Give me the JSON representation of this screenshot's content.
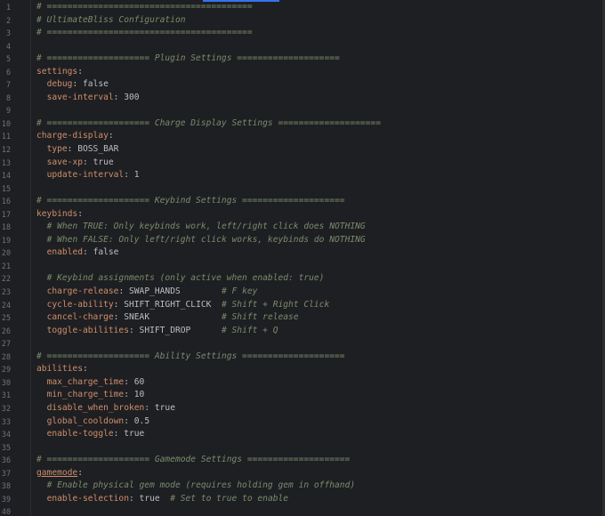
{
  "editor": {
    "language": "yaml",
    "colors": {
      "background": "#1e1f22",
      "line_number": "#6f737a",
      "comment": "#7a8c6e",
      "key": "#cf8e6d",
      "value": "#bcbec4",
      "accent": "#3574f0"
    },
    "lines": [
      {
        "n": "1",
        "tokens": [
          {
            "t": "comment",
            "v": "# ========================================"
          }
        ]
      },
      {
        "n": "2",
        "tokens": [
          {
            "t": "comment",
            "v": "# UltimateBliss Configuration"
          }
        ]
      },
      {
        "n": "3",
        "tokens": [
          {
            "t": "comment",
            "v": "# ========================================"
          }
        ]
      },
      {
        "n": "4",
        "tokens": []
      },
      {
        "n": "5",
        "tokens": [
          {
            "t": "comment",
            "v": "# ==================== Plugin Settings ===================="
          }
        ]
      },
      {
        "n": "6",
        "tokens": [
          {
            "t": "key",
            "v": "settings"
          },
          {
            "t": "punct",
            "v": ":"
          }
        ]
      },
      {
        "n": "7",
        "tokens": [
          {
            "t": "value",
            "v": "  "
          },
          {
            "t": "key",
            "v": "debug"
          },
          {
            "t": "punct",
            "v": ": "
          },
          {
            "t": "value",
            "v": "false"
          }
        ]
      },
      {
        "n": "8",
        "tokens": [
          {
            "t": "value",
            "v": "  "
          },
          {
            "t": "key",
            "v": "save-interval"
          },
          {
            "t": "punct",
            "v": ": "
          },
          {
            "t": "value",
            "v": "300"
          }
        ]
      },
      {
        "n": "9",
        "tokens": []
      },
      {
        "n": "10",
        "tokens": [
          {
            "t": "comment",
            "v": "# ==================== Charge Display Settings ===================="
          }
        ]
      },
      {
        "n": "11",
        "tokens": [
          {
            "t": "key",
            "v": "charge-display"
          },
          {
            "t": "punct",
            "v": ":"
          }
        ]
      },
      {
        "n": "12",
        "tokens": [
          {
            "t": "value",
            "v": "  "
          },
          {
            "t": "key",
            "v": "type"
          },
          {
            "t": "punct",
            "v": ": "
          },
          {
            "t": "value",
            "v": "BOSS_BAR"
          }
        ]
      },
      {
        "n": "13",
        "tokens": [
          {
            "t": "value",
            "v": "  "
          },
          {
            "t": "key",
            "v": "save-xp"
          },
          {
            "t": "punct",
            "v": ": "
          },
          {
            "t": "value",
            "v": "true"
          }
        ]
      },
      {
        "n": "14",
        "tokens": [
          {
            "t": "value",
            "v": "  "
          },
          {
            "t": "key",
            "v": "update-interval"
          },
          {
            "t": "punct",
            "v": ": "
          },
          {
            "t": "value",
            "v": "1"
          }
        ]
      },
      {
        "n": "15",
        "tokens": []
      },
      {
        "n": "16",
        "tokens": [
          {
            "t": "comment",
            "v": "# ==================== Keybind Settings ===================="
          }
        ]
      },
      {
        "n": "17",
        "tokens": [
          {
            "t": "key",
            "v": "keybinds"
          },
          {
            "t": "punct",
            "v": ":"
          }
        ]
      },
      {
        "n": "18",
        "tokens": [
          {
            "t": "value",
            "v": "  "
          },
          {
            "t": "comment",
            "v": "# When TRUE: Only keybinds work, left/right click does NOTHING"
          }
        ]
      },
      {
        "n": "19",
        "tokens": [
          {
            "t": "value",
            "v": "  "
          },
          {
            "t": "comment",
            "v": "# When FALSE: Only left/right click works, keybinds do NOTHING"
          }
        ]
      },
      {
        "n": "20",
        "tokens": [
          {
            "t": "value",
            "v": "  "
          },
          {
            "t": "key",
            "v": "enabled"
          },
          {
            "t": "punct",
            "v": ": "
          },
          {
            "t": "value",
            "v": "false"
          }
        ]
      },
      {
        "n": "21",
        "tokens": []
      },
      {
        "n": "22",
        "tokens": [
          {
            "t": "value",
            "v": "  "
          },
          {
            "t": "comment",
            "v": "# Keybind assignments (only active when enabled: true)"
          }
        ]
      },
      {
        "n": "23",
        "tokens": [
          {
            "t": "value",
            "v": "  "
          },
          {
            "t": "key",
            "v": "charge-release"
          },
          {
            "t": "punct",
            "v": ": "
          },
          {
            "t": "value",
            "v": "SWAP_HANDS        "
          },
          {
            "t": "comment",
            "v": "# F key"
          }
        ]
      },
      {
        "n": "24",
        "tokens": [
          {
            "t": "value",
            "v": "  "
          },
          {
            "t": "key",
            "v": "cycle-ability"
          },
          {
            "t": "punct",
            "v": ": "
          },
          {
            "t": "value",
            "v": "SHIFT_RIGHT_CLICK  "
          },
          {
            "t": "comment",
            "v": "# Shift + Right Click"
          }
        ]
      },
      {
        "n": "25",
        "tokens": [
          {
            "t": "value",
            "v": "  "
          },
          {
            "t": "key",
            "v": "cancel-charge"
          },
          {
            "t": "punct",
            "v": ": "
          },
          {
            "t": "value",
            "v": "SNEAK              "
          },
          {
            "t": "comment",
            "v": "# Shift release"
          }
        ]
      },
      {
        "n": "26",
        "tokens": [
          {
            "t": "value",
            "v": "  "
          },
          {
            "t": "key",
            "v": "toggle-abilities"
          },
          {
            "t": "punct",
            "v": ": "
          },
          {
            "t": "value",
            "v": "SHIFT_DROP      "
          },
          {
            "t": "comment",
            "v": "# Shift + Q"
          }
        ]
      },
      {
        "n": "27",
        "tokens": []
      },
      {
        "n": "28",
        "tokens": [
          {
            "t": "comment",
            "v": "# ==================== Ability Settings ===================="
          }
        ]
      },
      {
        "n": "29",
        "tokens": [
          {
            "t": "key",
            "v": "abilities"
          },
          {
            "t": "punct",
            "v": ":"
          }
        ]
      },
      {
        "n": "30",
        "tokens": [
          {
            "t": "value",
            "v": "  "
          },
          {
            "t": "key",
            "v": "max_charge_time"
          },
          {
            "t": "punct",
            "v": ": "
          },
          {
            "t": "value",
            "v": "60"
          }
        ]
      },
      {
        "n": "31",
        "tokens": [
          {
            "t": "value",
            "v": "  "
          },
          {
            "t": "key",
            "v": "min_charge_time"
          },
          {
            "t": "punct",
            "v": ": "
          },
          {
            "t": "value",
            "v": "10"
          }
        ]
      },
      {
        "n": "32",
        "tokens": [
          {
            "t": "value",
            "v": "  "
          },
          {
            "t": "key",
            "v": "disable_when_broken"
          },
          {
            "t": "punct",
            "v": ": "
          },
          {
            "t": "value",
            "v": "true"
          }
        ]
      },
      {
        "n": "33",
        "tokens": [
          {
            "t": "value",
            "v": "  "
          },
          {
            "t": "key",
            "v": "global_cooldown"
          },
          {
            "t": "punct",
            "v": ": "
          },
          {
            "t": "value",
            "v": "0.5"
          }
        ]
      },
      {
        "n": "34",
        "tokens": [
          {
            "t": "value",
            "v": "  "
          },
          {
            "t": "key",
            "v": "enable-toggle"
          },
          {
            "t": "punct",
            "v": ": "
          },
          {
            "t": "value",
            "v": "true"
          }
        ]
      },
      {
        "n": "35",
        "tokens": []
      },
      {
        "n": "36",
        "tokens": [
          {
            "t": "comment",
            "v": "# ==================== Gamemode Settings ===================="
          }
        ]
      },
      {
        "n": "37",
        "tokens": [
          {
            "t": "key-u",
            "v": "gamemode"
          },
          {
            "t": "punct",
            "v": ":"
          }
        ]
      },
      {
        "n": "38",
        "tokens": [
          {
            "t": "value",
            "v": "  "
          },
          {
            "t": "comment",
            "v": "# Enable physical gem mode (requires holding gem in offhand)"
          }
        ]
      },
      {
        "n": "39",
        "tokens": [
          {
            "t": "value",
            "v": "  "
          },
          {
            "t": "key",
            "v": "enable-selection"
          },
          {
            "t": "punct",
            "v": ": "
          },
          {
            "t": "value",
            "v": "true  "
          },
          {
            "t": "comment",
            "v": "# Set to true to enable"
          }
        ]
      },
      {
        "n": "40",
        "tokens": []
      }
    ]
  }
}
